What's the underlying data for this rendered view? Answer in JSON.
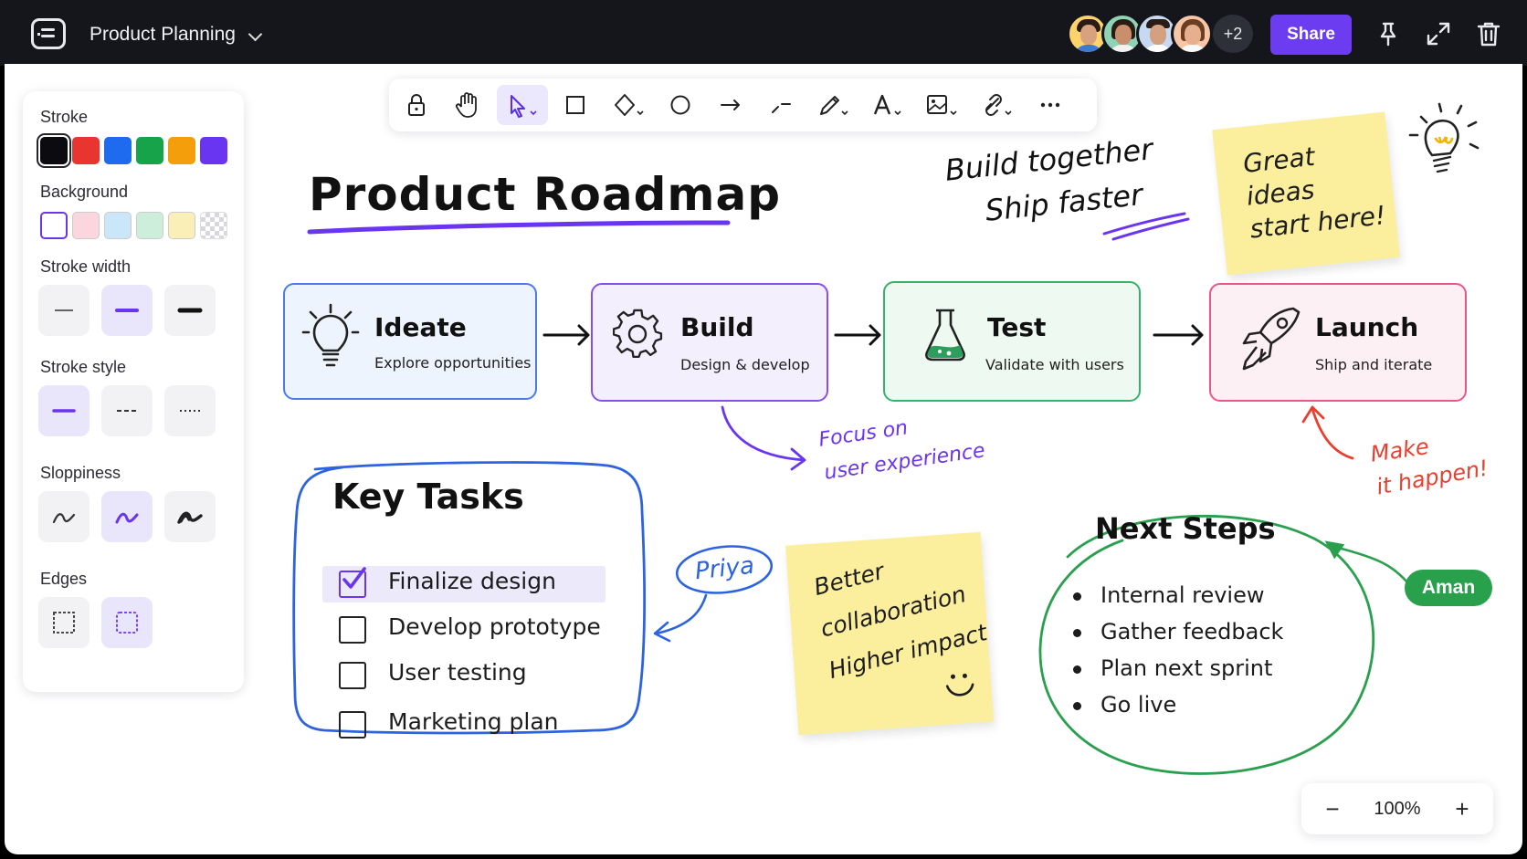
{
  "header": {
    "board_title": "Product Planning",
    "collaborators_more": "+2",
    "share_label": "Share"
  },
  "panel": {
    "stroke_label": "Stroke",
    "stroke_colors": [
      "#0b0b10",
      "#e8352f",
      "#1f6bf0",
      "#16a34a",
      "#f59e0b",
      "#6a35f0"
    ],
    "background_label": "Background",
    "background_colors": [
      "#ffffff",
      "#fcd6de",
      "#c9e7f8",
      "#cdeedb",
      "#fbefb8",
      "transparent"
    ],
    "stroke_width_label": "Stroke width",
    "stroke_style_label": "Stroke style",
    "sloppiness_label": "Sloppiness",
    "edges_label": "Edges"
  },
  "toolbar": {
    "tools": [
      "lock",
      "hand",
      "select",
      "rectangle",
      "diamond",
      "ellipse",
      "arrow",
      "line",
      "pencil",
      "text",
      "image",
      "link",
      "more"
    ],
    "selected": "select"
  },
  "board": {
    "title": "Product Roadmap",
    "tagline_line1": "Build together",
    "tagline_line2": "Ship faster",
    "sticky_ideas": [
      "Great",
      "ideas",
      "start here!"
    ],
    "stages": [
      {
        "title": "Ideate",
        "subtitle": "Explore opportunities",
        "icon": "lightbulb-icon",
        "color": "#4b7be8",
        "fill": "#eef4fd"
      },
      {
        "title": "Build",
        "subtitle": "Design & develop",
        "icon": "gear-icon",
        "color": "#8a4ee8",
        "fill": "#f3effd"
      },
      {
        "title": "Test",
        "subtitle": "Validate with users",
        "icon": "flask-icon",
        "color": "#35b36a",
        "fill": "#edf9f1"
      },
      {
        "title": "Launch",
        "subtitle": "Ship and iterate",
        "icon": "rocket-icon",
        "color": "#e8578a",
        "fill": "#fdf0f4"
      }
    ],
    "note_focus": [
      "Focus on",
      "user experience"
    ],
    "note_make": [
      "Make",
      "it happen!"
    ],
    "key_tasks": {
      "title": "Key Tasks",
      "items": [
        {
          "label": "Finalize design",
          "done": true
        },
        {
          "label": "Develop prototype",
          "done": false
        },
        {
          "label": "User testing",
          "done": false
        },
        {
          "label": "Marketing plan",
          "done": false
        }
      ]
    },
    "priya_label": "Priya",
    "sticky_collab": [
      "Better",
      "collaboration",
      "Higher impact"
    ],
    "next_steps": {
      "title": "Next Steps",
      "items": [
        "Internal review",
        "Gather feedback",
        "Plan next sprint",
        "Go live"
      ]
    },
    "aman_label": "Aman"
  },
  "zoom": {
    "minus": "−",
    "level": "100%",
    "plus": "+"
  }
}
